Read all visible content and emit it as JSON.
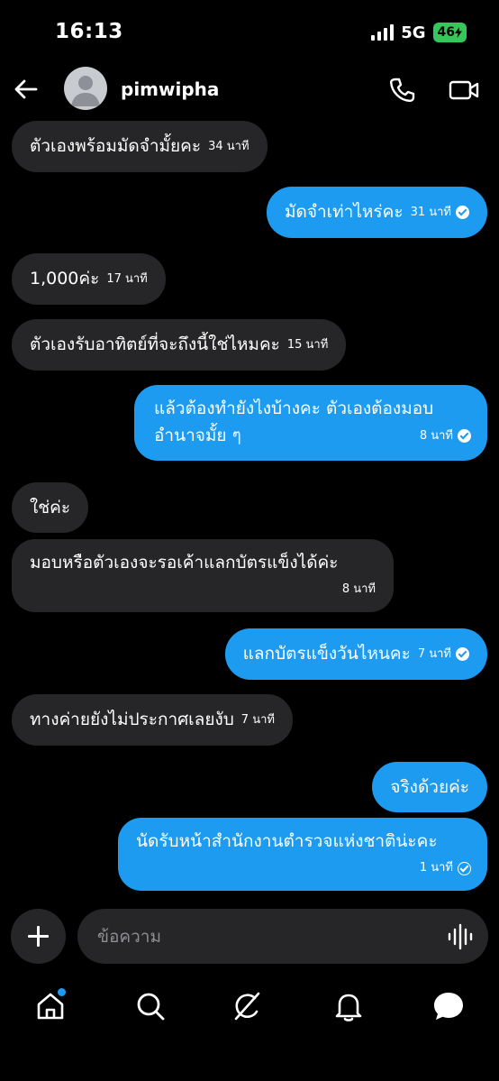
{
  "status_bar": {
    "time": "16:13",
    "network": "5G",
    "battery": "46"
  },
  "header": {
    "contact_name": "pimwipha"
  },
  "messages": [
    {
      "direction": "in",
      "text": "ตัวเองพร้อมมัดจำมั้ยคะ",
      "time": "34 นาที"
    },
    {
      "direction": "out",
      "text": "มัดจำเท่าไหร่คะ",
      "time": "31 นาที",
      "status": "read"
    },
    {
      "direction": "in",
      "text": "1,000ค่ะ",
      "time": "17 นาที"
    },
    {
      "direction": "in",
      "text": "ตัวเองรับอาทิตย์ที่จะถึงนี้ใช่ไหมคะ",
      "time": "15 นาที"
    },
    {
      "direction": "out",
      "text_line1": "แล้วต้องทำยังไงบ้างคะ ตัวเองต้องมอบ",
      "text_line2": "อำนาจมั้ย ๆ",
      "time": "8 นาที",
      "status": "read"
    },
    {
      "direction": "in",
      "text": "ใช่ค่ะ"
    },
    {
      "direction": "in",
      "text": "มอบหรือตัวเองจะรอเค้าแลกบัตรแข็งได้ค่ะ",
      "time": "8 นาที"
    },
    {
      "direction": "out",
      "text": "แลกบัตรแข็งวันไหนคะ",
      "time": "7 นาที",
      "status": "read"
    },
    {
      "direction": "in",
      "text": "ทางค่ายยังไม่ประกาศเลยงับ",
      "time": "7 นาที"
    },
    {
      "direction": "out",
      "text": "จริงด้วยค่ะ"
    },
    {
      "direction": "out",
      "text": "นัดรับหน้าสำนักงานตำรวจแห่งชาติน่ะคะ",
      "time": "1 นาที",
      "status": "sent"
    }
  ],
  "composer": {
    "placeholder": "ข้อความ"
  },
  "colors": {
    "background": "#000000",
    "incoming_bubble": "#262628",
    "outgoing_bubble": "#1d9bf0",
    "battery": "#34c759"
  },
  "bottom_nav": {
    "items": [
      "home-icon",
      "search-icon",
      "grok-icon",
      "notifications-icon",
      "messages-icon"
    ]
  }
}
